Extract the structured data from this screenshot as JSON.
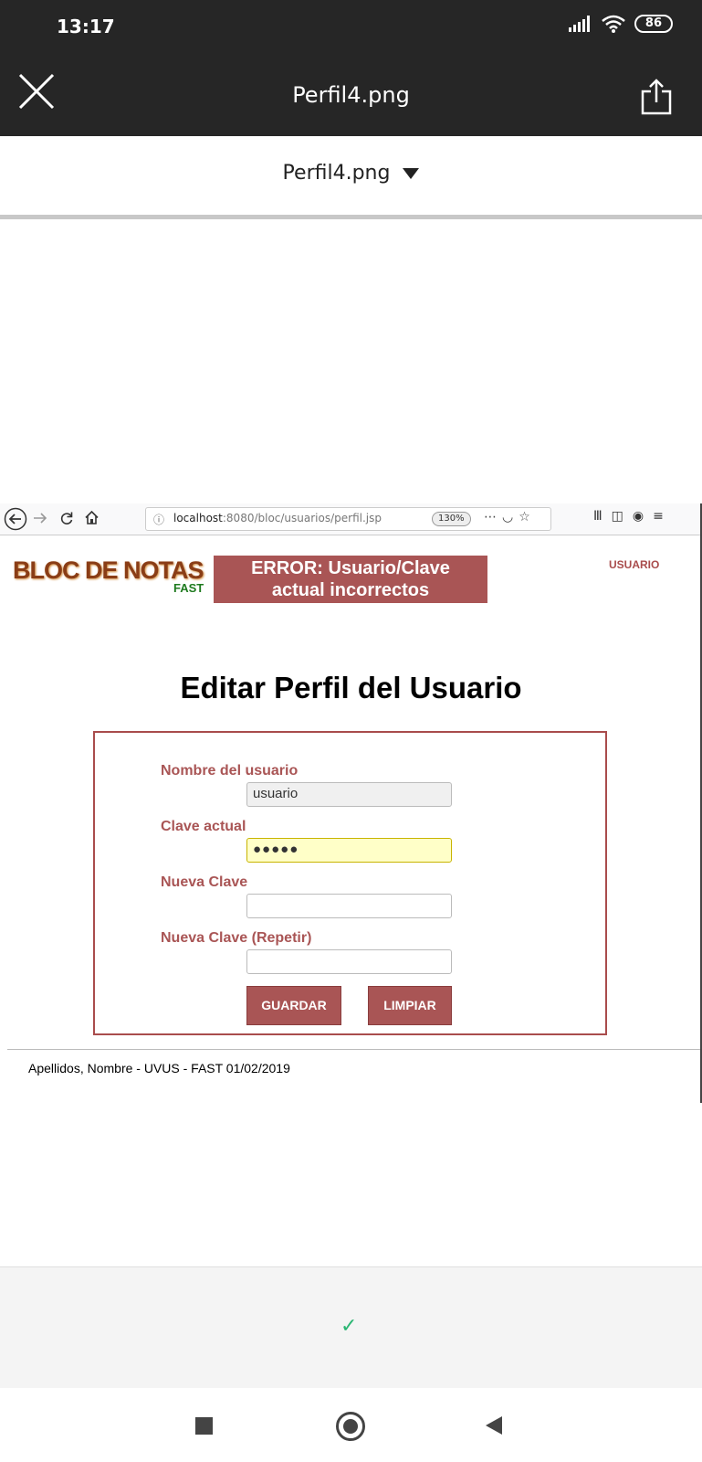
{
  "status": {
    "time": "13:17",
    "battery": "86"
  },
  "viewer": {
    "title": "Perfil4.png",
    "file_dropdown": "Perfil4.png"
  },
  "browser": {
    "url_host": "localhost",
    "url_path": ":8080/bloc/usuarios/perfil.jsp",
    "zoom": "130%"
  },
  "app": {
    "logo": "BLOC DE NOTAS",
    "logo_sub": "FAST",
    "error_line1": "ERROR: Usuario/Clave",
    "error_line2": "actual incorrectos",
    "user_link": "USUARIO",
    "heading": "Editar Perfil del Usuario",
    "form": {
      "username_label": "Nombre del usuario",
      "username_value": "usuario",
      "current_password_label": "Clave actual",
      "current_password_value": "●●●●●",
      "new_password_label": "Nueva Clave",
      "repeat_password_label": "Nueva Clave (Repetir)",
      "save_button": "GUARDAR",
      "clear_button": "LIMPIAR"
    },
    "footer": "Apellidos, Nombre - UVUS - FAST 01/02/2019"
  },
  "colors": {
    "accent": "#a95555",
    "check": "#2bb673"
  }
}
